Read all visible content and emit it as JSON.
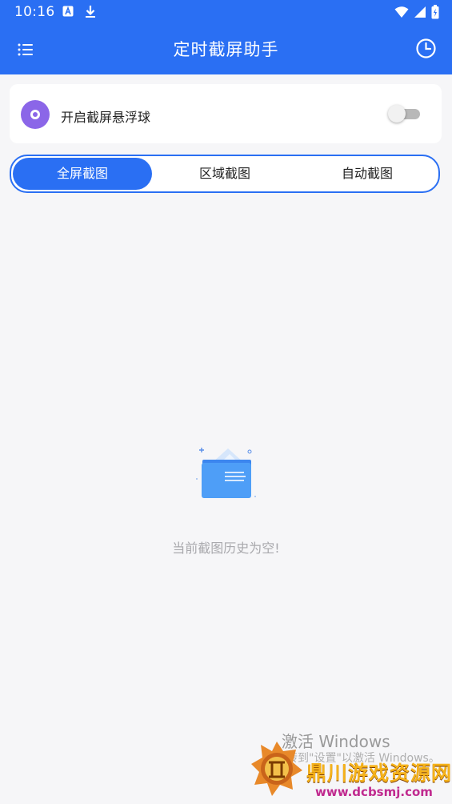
{
  "status_bar": {
    "time": "10:16",
    "icons": [
      "a-icon",
      "download-icon",
      "wifi-icon",
      "signal-icon",
      "battery-icon"
    ]
  },
  "app_bar": {
    "title": "定时截屏助手",
    "left_icon": "menu-list-icon",
    "right_icon": "clock-history-icon",
    "background": "#2a6ff3"
  },
  "floating_ball": {
    "label": "开启截屏悬浮球",
    "icon": "disc-icon",
    "icon_color": "#8b66e8",
    "enabled": false
  },
  "tabs": [
    {
      "label": "全屏截图",
      "active": true
    },
    {
      "label": "区域截图",
      "active": false
    },
    {
      "label": "自动截图",
      "active": false
    }
  ],
  "empty_state": {
    "icon": "empty-folder-icon",
    "message": "当前截图历史为空!"
  },
  "watermark": {
    "windows_line1": "激活 Windows",
    "windows_line2": "转到\"设置\"以激活 Windows。",
    "site_name": "鼎川游戏资源网",
    "site_url": "www.dcbsmj.com"
  }
}
